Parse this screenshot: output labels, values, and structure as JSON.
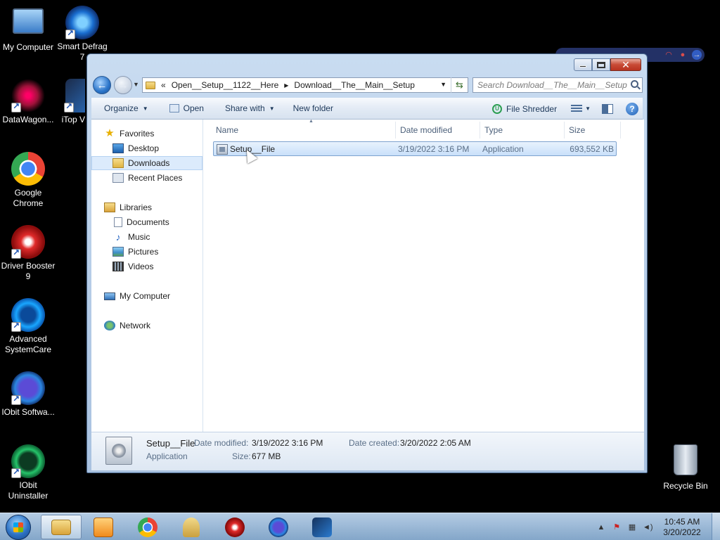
{
  "desktop": {
    "icons": [
      {
        "label": "My Computer",
        "icon": "my-computer-icon"
      },
      {
        "label": "Smart Defrag 7",
        "icon": "smart-defrag-icon"
      },
      {
        "label": "DataWagon...",
        "icon": "datawagon-icon"
      },
      {
        "label": "iTop V",
        "icon": "itop-icon"
      },
      {
        "label": "Google Chrome",
        "icon": "chrome-icon"
      },
      {
        "label": "Driver Booster 9",
        "icon": "driver-booster-icon"
      },
      {
        "label": "Advanced SystemCare",
        "icon": "advanced-systemcare-icon"
      },
      {
        "label": "IObit Softwa...",
        "icon": "iobit-software-icon"
      },
      {
        "label": "IObit Uninstaller",
        "icon": "iobit-uninstaller-icon"
      },
      {
        "label": "Recycle Bin",
        "icon": "recycle-bin-icon"
      }
    ]
  },
  "explorer": {
    "address": {
      "overflow": "«",
      "crumbs": [
        "Open__Setup__1122__Here",
        "Download__The__Main__Setup"
      ]
    },
    "search": {
      "placeholder": "Search Download__The__Main__Setup"
    },
    "toolbar": {
      "organize": "Organize",
      "open": "Open",
      "share_with": "Share with",
      "new_folder": "New folder",
      "file_shredder": "File Shredder"
    },
    "nav": {
      "favorites": "Favorites",
      "desktop": "Desktop",
      "downloads": "Downloads",
      "recent_places": "Recent Places",
      "libraries": "Libraries",
      "documents": "Documents",
      "music": "Music",
      "pictures": "Pictures",
      "videos": "Videos",
      "my_computer": "My Computer",
      "network": "Network"
    },
    "columns": {
      "name": "Name",
      "date_modified": "Date modified",
      "type": "Type",
      "size": "Size"
    },
    "files": [
      {
        "name": "Setup__File",
        "date_modified": "3/19/2022 3:16 PM",
        "type": "Application",
        "size": "693,552 KB"
      }
    ],
    "details": {
      "name": "Setup__File",
      "type": "Application",
      "date_modified_label": "Date modified:",
      "date_modified": "3/19/2022 3:16 PM",
      "size_label": "Size:",
      "size": "677 MB",
      "date_created_label": "Date created:",
      "date_created": "3/20/2022 2:05 AM"
    }
  },
  "taskbar": {
    "time": "10:45 AM",
    "date": "3/20/2022"
  },
  "colors": {
    "selection": "#c9e0fa",
    "window_frame": "#b4cbe6",
    "taskbar": "#8aafd4"
  }
}
